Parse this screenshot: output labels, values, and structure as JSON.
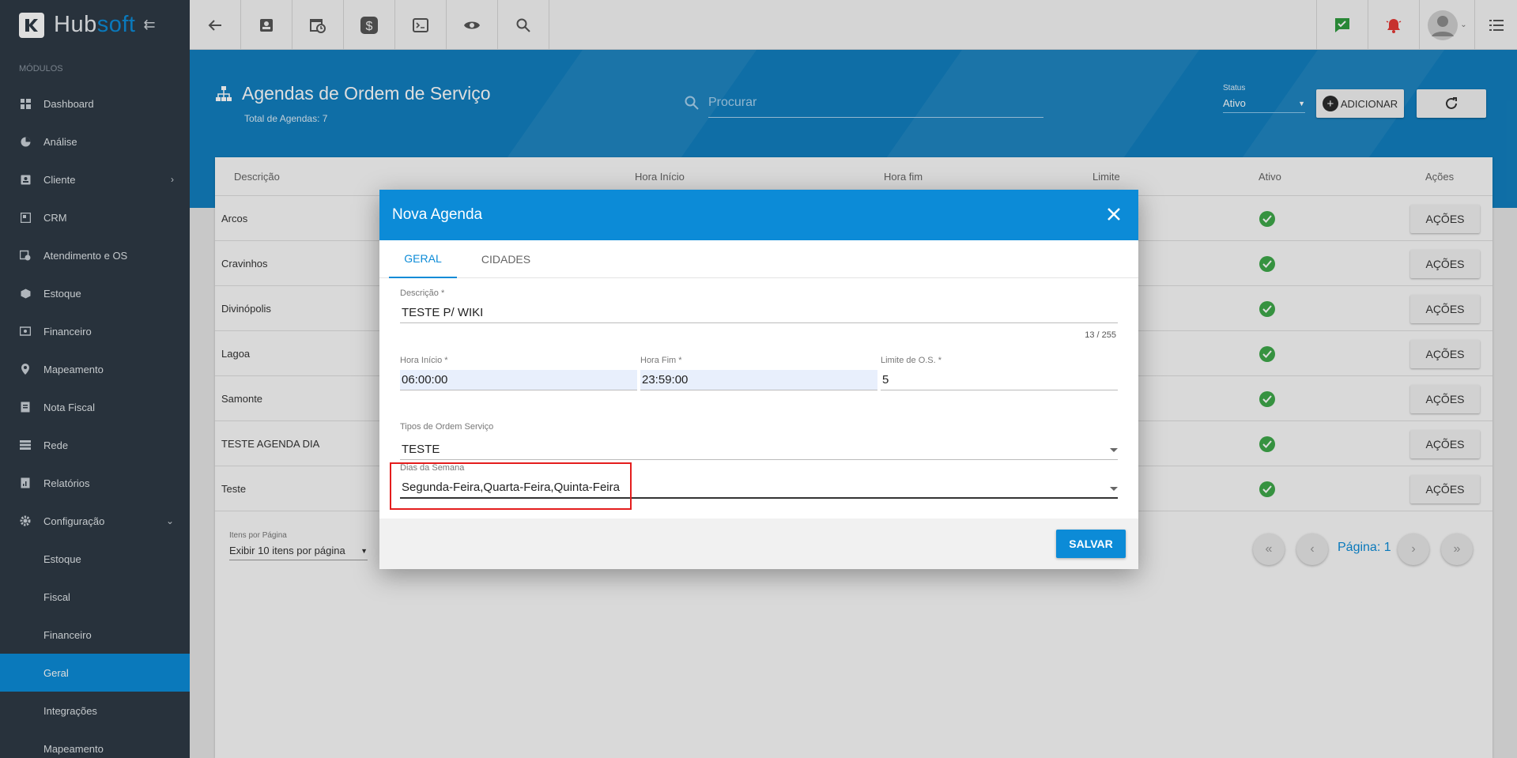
{
  "app": {
    "brand_hub": "Hub",
    "brand_soft": "soft",
    "collapse_icon": "menu-collapse-icon"
  },
  "sidebar": {
    "section_label": "MÓDULOS",
    "items": [
      {
        "label": "Dashboard",
        "icon": "dashboard-icon"
      },
      {
        "label": "Análise",
        "icon": "pie-chart-icon"
      },
      {
        "label": "Cliente",
        "icon": "contact-card-icon",
        "has_children": true
      },
      {
        "label": "CRM",
        "icon": "crm-icon"
      },
      {
        "label": "Atendimento e OS",
        "icon": "calendar-clock-icon"
      },
      {
        "label": "Estoque",
        "icon": "box-icon"
      },
      {
        "label": "Financeiro",
        "icon": "money-icon"
      },
      {
        "label": "Mapeamento",
        "icon": "map-pin-icon"
      },
      {
        "label": "Nota Fiscal",
        "icon": "document-icon"
      },
      {
        "label": "Rede",
        "icon": "server-icon"
      },
      {
        "label": "Relatórios",
        "icon": "report-icon"
      },
      {
        "label": "Configuração",
        "icon": "gear-icon",
        "expanded": true
      }
    ],
    "sub_items": [
      "Estoque",
      "Fiscal",
      "Financeiro",
      "Geral",
      "Integrações",
      "Mapeamento"
    ],
    "active_sub": "Geral"
  },
  "page": {
    "title": "Agendas de Ordem de Serviço",
    "subtitle": "Total de Agendas: 7",
    "search_placeholder": "Procurar",
    "status_label": "Status",
    "status_value": "Ativo",
    "add_label": "ADICIONAR"
  },
  "table": {
    "headers": [
      "Descrição",
      "Hora Início",
      "Hora fim",
      "Limite",
      "Ativo",
      "Ações"
    ],
    "rows": [
      {
        "descricao": "Arcos",
        "ativo": true,
        "acoes": "AÇÕES"
      },
      {
        "descricao": "Cravinhos",
        "ativo": true,
        "acoes": "AÇÕES"
      },
      {
        "descricao": "Divinópolis",
        "ativo": true,
        "acoes": "AÇÕES"
      },
      {
        "descricao": "Lagoa",
        "ativo": true,
        "acoes": "AÇÕES"
      },
      {
        "descricao": "Samonte",
        "ativo": true,
        "acoes": "AÇÕES"
      },
      {
        "descricao": "TESTE AGENDA DIA",
        "ativo": true,
        "acoes": "AÇÕES"
      },
      {
        "descricao": "Teste",
        "ativo": true,
        "acoes": "AÇÕES"
      }
    ],
    "per_page_label": "Itens por Página",
    "per_page_value": "Exibir 10 itens por página",
    "page_label": "Página: 1"
  },
  "modal": {
    "title": "Nova Agenda",
    "tabs": [
      "GERAL",
      "CIDADES"
    ],
    "active_tab": "GERAL",
    "descricao_label": "Descrição *",
    "descricao_value": "TESTE P/ WIKI",
    "counter": "13 / 255",
    "hora_inicio_label": "Hora Início *",
    "hora_inicio_value": "06:00:00",
    "hora_fim_label": "Hora Fim *",
    "hora_fim_value": "23:59:00",
    "limite_label": "Limite de O.S. *",
    "limite_value": "5",
    "tipos_label": "Tipos de Ordem Serviço",
    "tipos_value": "TESTE",
    "dias_label": "Dias da Semana",
    "dias_value": "Segunda-Feira,Quarta-Feira,Quinta-Feira",
    "save_label": "SALVAR"
  },
  "colors": {
    "primary": "#0c8bd7",
    "sidebar": "#2f3a45",
    "success": "#3ea84a",
    "alert": "#e53935",
    "highlight": "#e41d1d"
  }
}
